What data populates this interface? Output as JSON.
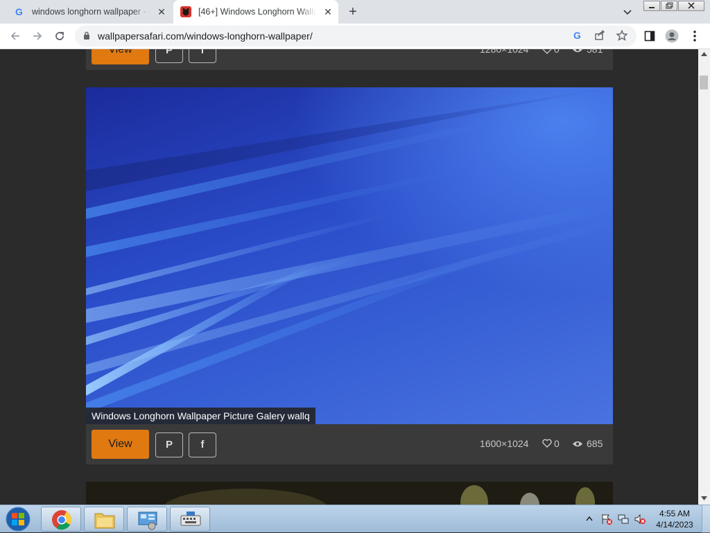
{
  "browser": {
    "tabs": [
      {
        "title": "windows longhorn wallpaper - G",
        "active": false
      },
      {
        "title": "[46+] Windows Longhorn Wallpa",
        "active": true
      }
    ],
    "close_glyph": "✕",
    "new_tab_glyph": "+",
    "url": "wallpapersafari.com/windows-longhorn-wallpaper/"
  },
  "page": {
    "top_card": {
      "view_label": "View",
      "resolution": "1280×1024",
      "likes": "0",
      "views": "581"
    },
    "main_card": {
      "caption": "Windows Longhorn Wallpaper Picture Galery wallq",
      "view_label": "View",
      "pinterest_glyph": "P",
      "facebook_glyph": "f",
      "resolution": "1600×1024",
      "likes": "0",
      "views": "685"
    },
    "colors": {
      "view_button": "#e07a10",
      "page_bg": "#2b2b2b",
      "card_bg": "#3a3a3a"
    }
  },
  "taskbar": {
    "time": "4:55 AM",
    "date": "4/14/2023"
  }
}
